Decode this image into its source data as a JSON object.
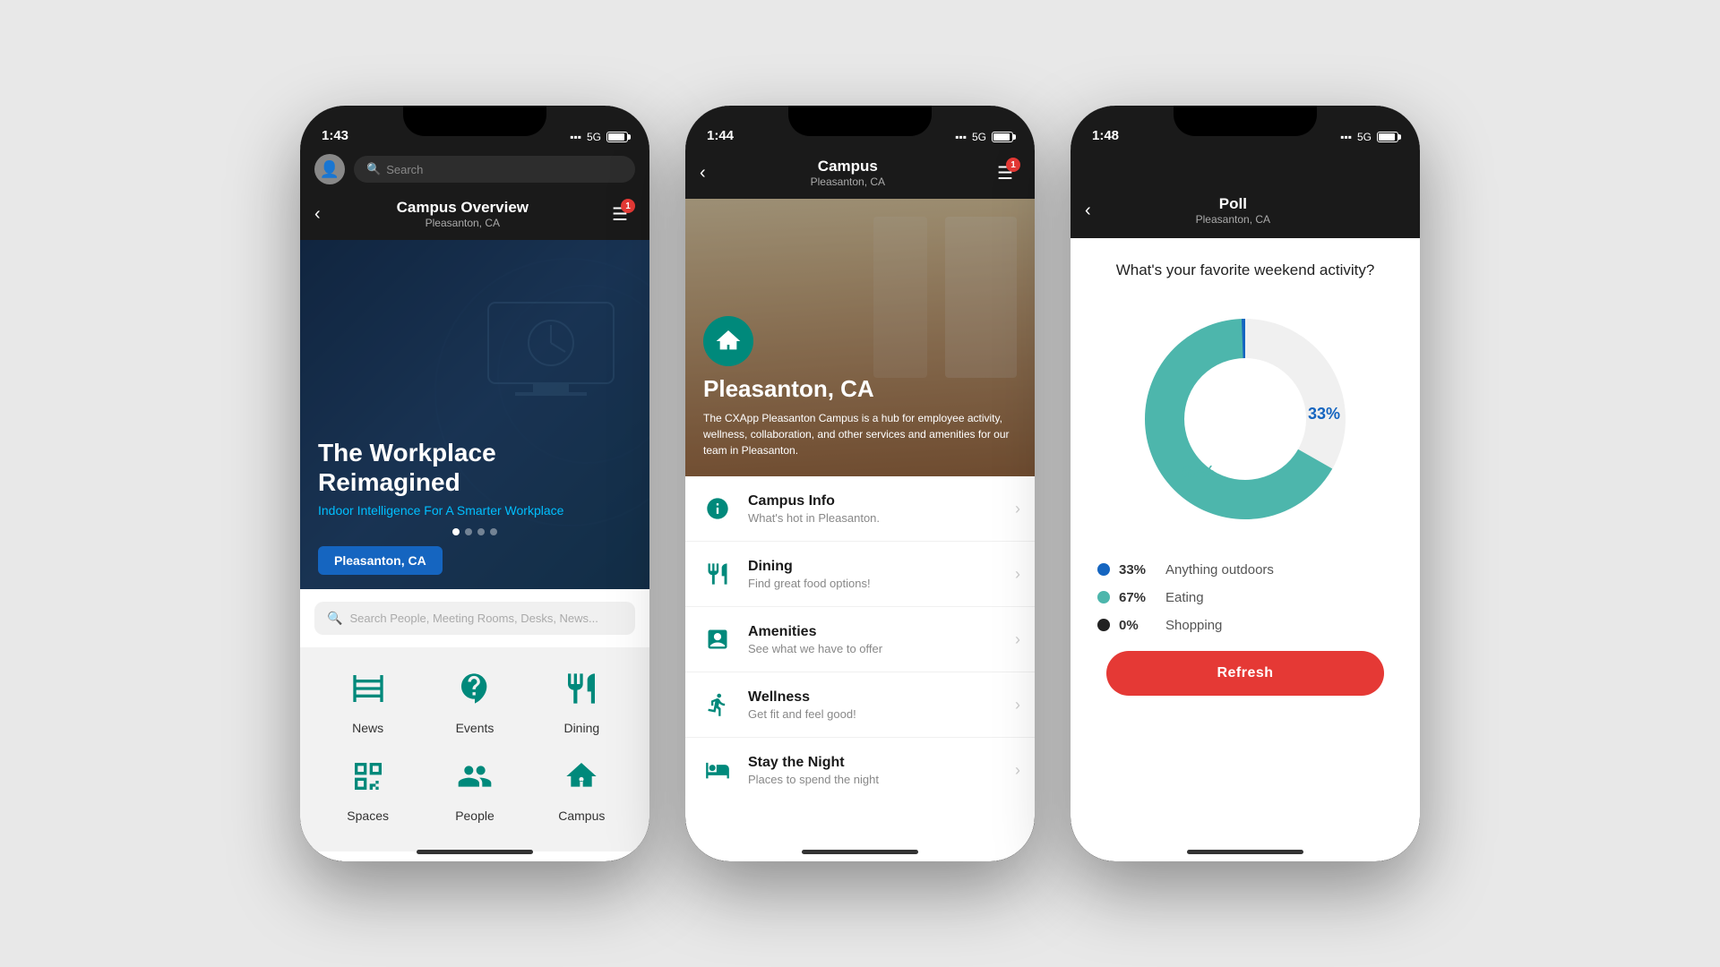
{
  "phone1": {
    "status_time": "1:43",
    "network": "5G",
    "title": "Campus Overview",
    "subtitle": "Pleasanton, CA",
    "search_hint": "Search",
    "hero_title": "The Workplace Reimagined",
    "hero_subtitle": "Indoor Intelligence For A Smarter Workplace",
    "location_badge": "Pleasanton, CA",
    "search_placeholder": "Search People, Meeting Rooms, Desks, News...",
    "grid_items": [
      {
        "label": "News",
        "icon": "news"
      },
      {
        "label": "Events",
        "icon": "events"
      },
      {
        "label": "Dining",
        "icon": "dining"
      },
      {
        "label": "Spaces",
        "icon": "spaces"
      },
      {
        "label": "People",
        "icon": "people"
      },
      {
        "label": "Campus",
        "icon": "campus"
      }
    ],
    "notification_count": "1"
  },
  "phone2": {
    "status_time": "1:44",
    "network": "5G",
    "title": "Campus",
    "subtitle": "Pleasanton, CA",
    "campus_name": "Pleasanton, CA",
    "campus_desc": "The CXApp Pleasanton Campus is a hub for employee activity, wellness, collaboration, and other services and amenities for our team in Pleasanton.",
    "notification_count": "1",
    "menu_items": [
      {
        "title": "Campus Info",
        "sub": "What's hot in Pleasanton.",
        "icon": "info"
      },
      {
        "title": "Dining",
        "sub": "Find great food options!",
        "icon": "dining"
      },
      {
        "title": "Amenities",
        "sub": "See what we have to offer",
        "icon": "amenities"
      },
      {
        "title": "Wellness",
        "sub": "Get fit and feel good!",
        "icon": "wellness"
      },
      {
        "title": "Stay the Night",
        "sub": "Places to spend the night",
        "icon": "bed"
      }
    ]
  },
  "phone3": {
    "status_time": "1:48",
    "network": "5G",
    "title": "Poll",
    "subtitle": "Pleasanton, CA",
    "poll_question": "What's your favorite weekend activity?",
    "chart_segments": [
      {
        "label": "Anything outdoors",
        "pct": 33,
        "color": "#1565c0"
      },
      {
        "label": "Eating",
        "pct": 67,
        "color": "#4db6ac"
      },
      {
        "label": "Shopping",
        "pct": 0,
        "color": "#222"
      }
    ],
    "chart_center_label": "",
    "legend": [
      {
        "pct": "33%",
        "label": "Anything outdoors",
        "color": "#1565c0"
      },
      {
        "pct": "67%",
        "label": "Eating",
        "color": "#4db6ac"
      },
      {
        "pct": "0%",
        "label": "Shopping",
        "color": "#222"
      }
    ],
    "refresh_label": "Refresh",
    "segment_labels": [
      {
        "pct": "33%",
        "x": "310",
        "y": "155"
      },
      {
        "pct": "67%",
        "x": "105",
        "y": "320"
      }
    ]
  }
}
